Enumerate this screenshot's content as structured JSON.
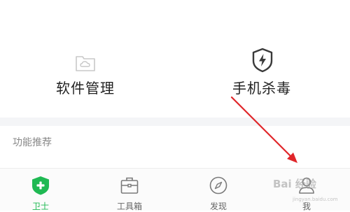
{
  "features": {
    "software_manager": {
      "label": "软件管理",
      "icon": "folder-cloud-icon"
    },
    "antivirus": {
      "label": "手机杀毒",
      "icon": "shield-lightning-icon"
    }
  },
  "section": {
    "title": "功能推荐"
  },
  "tabbar": {
    "items": [
      {
        "label": "卫士",
        "icon": "shield-plus-icon",
        "active": true
      },
      {
        "label": "工具箱",
        "icon": "toolbox-icon",
        "active": false
      },
      {
        "label": "发现",
        "icon": "compass-icon",
        "active": false
      },
      {
        "label": "我",
        "icon": "person-icon",
        "active": false
      }
    ]
  },
  "watermark": {
    "text": "Bai 经验",
    "sub": "jingyan.baidu.com"
  },
  "colors": {
    "accent": "#1fb953",
    "annotation_arrow": "#e0262a",
    "divider_band": "#f4f5f7",
    "text_primary": "#222222",
    "text_secondary": "#888888"
  }
}
